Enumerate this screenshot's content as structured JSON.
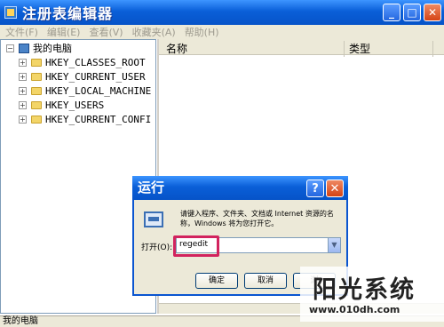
{
  "window": {
    "title": "注册表编辑器",
    "minimize": "_",
    "maximize": "□",
    "close": "✕"
  },
  "menu": [
    "文件(F)",
    "编辑(E)",
    "查看(V)",
    "收藏夹(A)",
    "帮助(H)"
  ],
  "tree": {
    "root": "我的电脑",
    "items": [
      "HKEY_CLASSES_ROOT",
      "HKEY_CURRENT_USER",
      "HKEY_LOCAL_MACHINE",
      "HKEY_USERS",
      "HKEY_CURRENT_CONFI"
    ]
  },
  "columns": {
    "name": "名称",
    "type": "类型"
  },
  "status": "我的电脑",
  "run_dialog": {
    "title": "运行",
    "help": "?",
    "close": "✕",
    "description": "请键入程序、文件夹、文档或 Internet 资源的名称，Windows 将为您打开它。",
    "open_label": "打开(O):",
    "input_value": "regedit",
    "ok": "确定",
    "cancel": "取消",
    "browse": "浏"
  },
  "watermark": {
    "main": "阳光系统",
    "url": "www.010dh.com"
  }
}
